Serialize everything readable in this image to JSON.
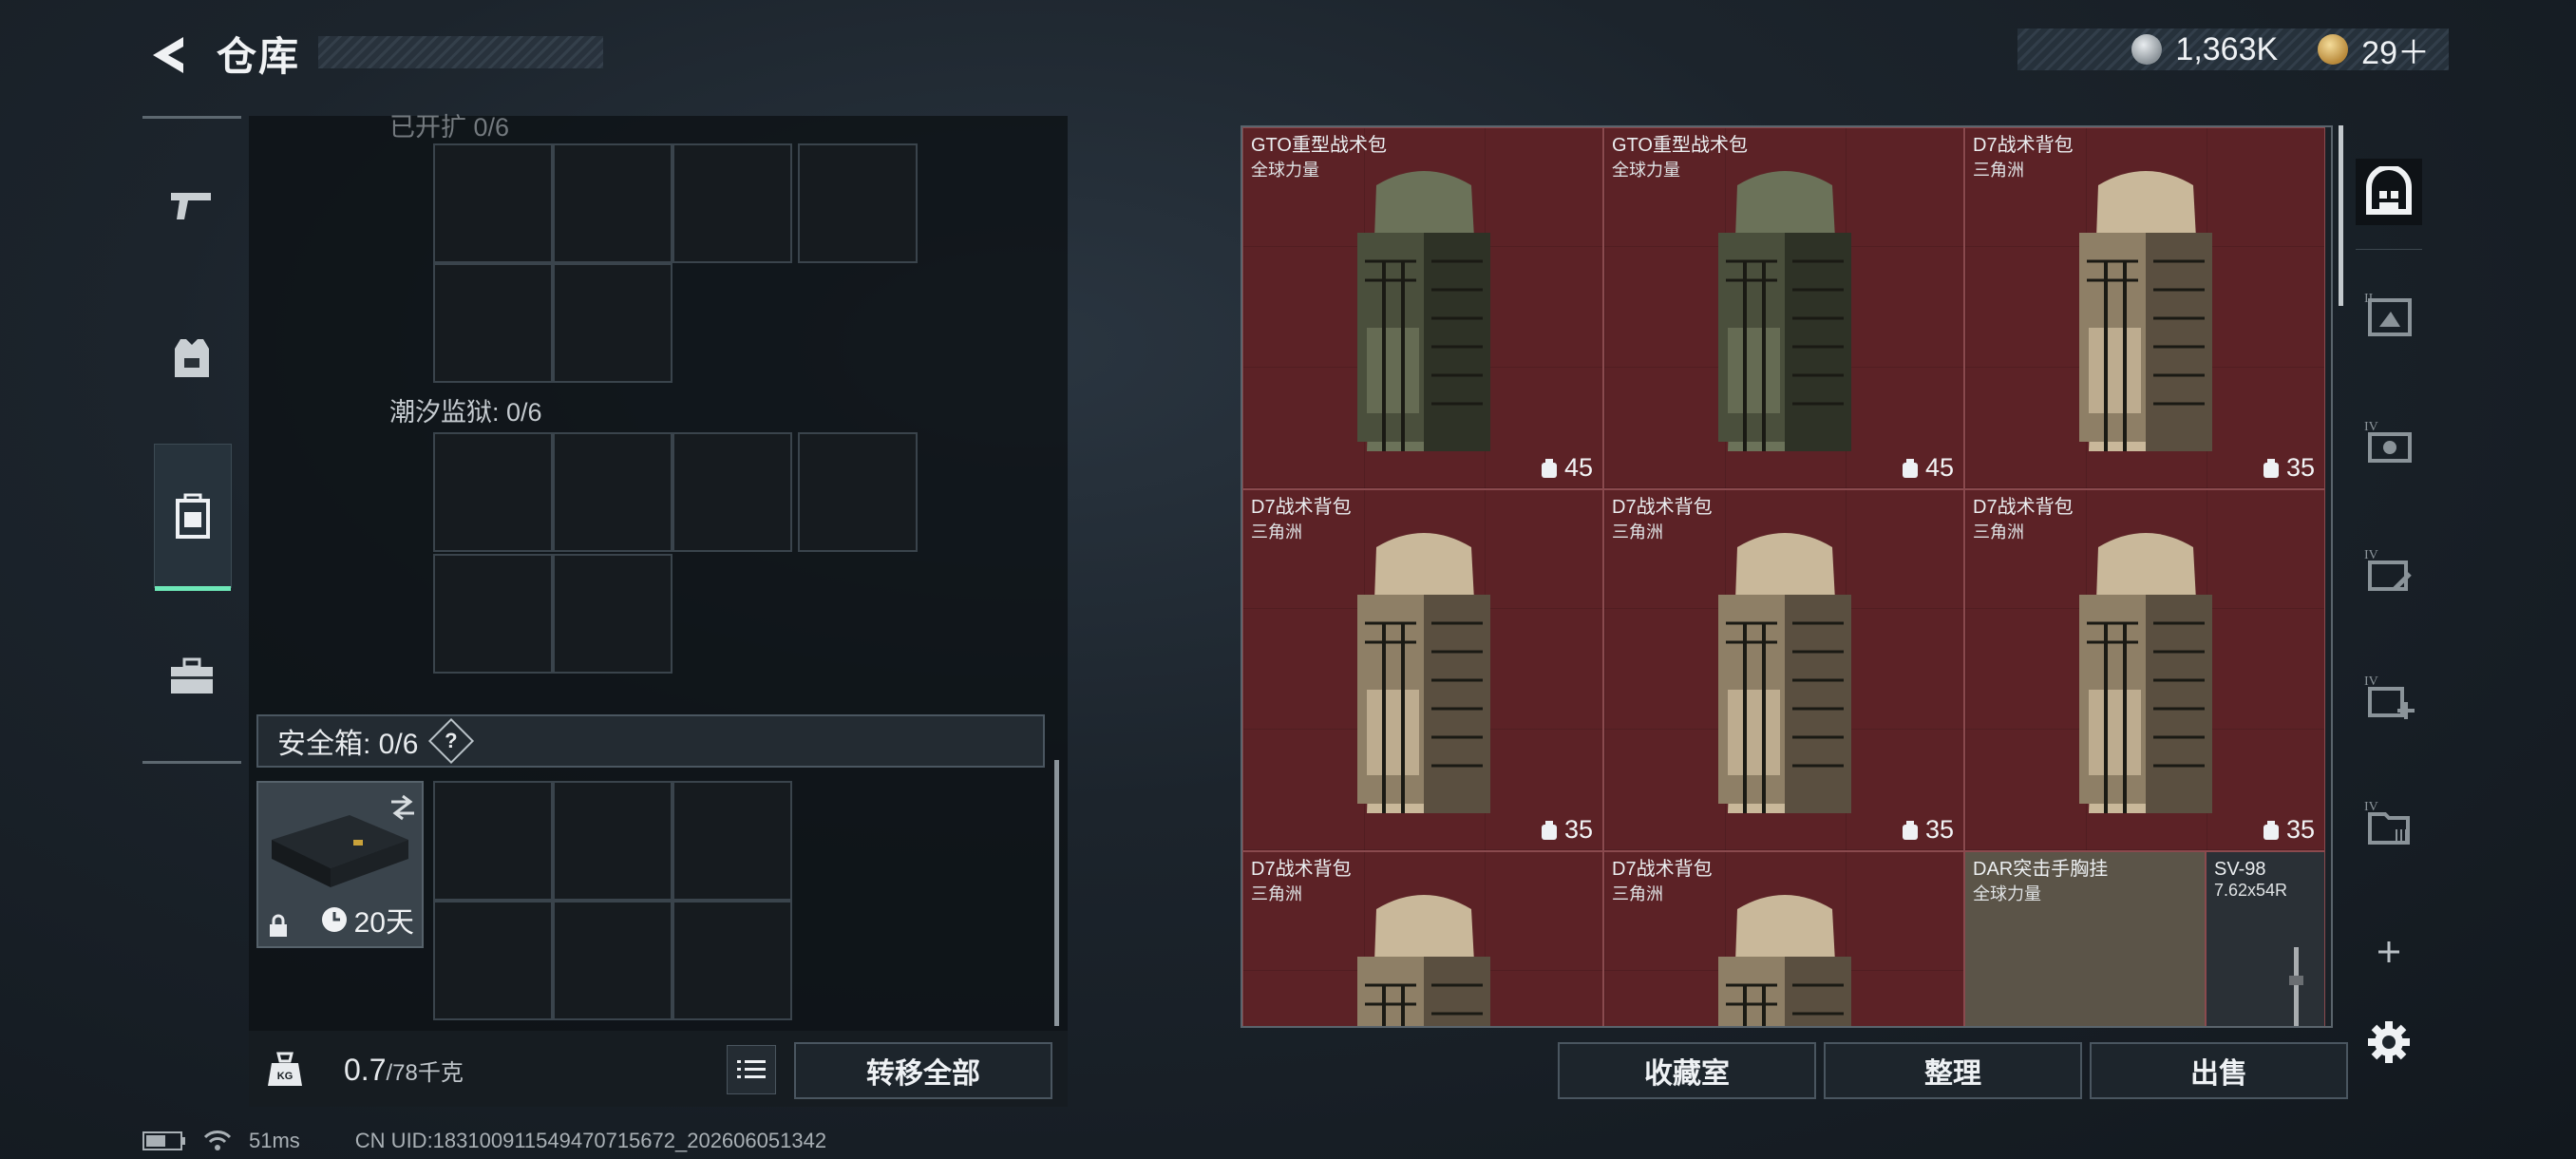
{
  "header": {
    "title": "仓库",
    "back_icon": "back-arrow-icon"
  },
  "currency": {
    "silver_value": "1,363K",
    "gold_value": "29＋",
    "silver_icon": "silver-coin-icon",
    "gold_icon": "gold-coin-icon"
  },
  "left_rail": [
    {
      "id": "weapons",
      "icon": "pistol-icon",
      "active": false
    },
    {
      "id": "armor",
      "icon": "vest-icon",
      "active": false
    },
    {
      "id": "backpack",
      "icon": "backpack-icon",
      "active": true
    },
    {
      "id": "toolbox",
      "icon": "briefcase-icon",
      "active": false
    }
  ],
  "containers": {
    "top_label_cut": "已开扩 0/6",
    "tide_prison_label": "潮汐监狱: 0/6",
    "safe_box_label": "安全箱: 0/6",
    "safe_box_help": "?",
    "safe_box_days": "20天"
  },
  "weight": {
    "current": "0.7",
    "max_unit": "/78千克"
  },
  "buttons": {
    "transfer_all": "转移全部",
    "collection": "收藏室",
    "organize": "整理",
    "sell": "出售"
  },
  "inventory": [
    {
      "name": "GTO重型战术包",
      "brand": "全球力量",
      "count": "45",
      "color": "green"
    },
    {
      "name": "GTO重型战术包",
      "brand": "全球力量",
      "count": "45",
      "color": "green"
    },
    {
      "name": "D7战术背包",
      "brand": "三角洲",
      "count": "35",
      "color": "tan"
    },
    {
      "name": "D7战术背包",
      "brand": "三角洲",
      "count": "35",
      "color": "tan"
    },
    {
      "name": "D7战术背包",
      "brand": "三角洲",
      "count": "35",
      "color": "tan"
    },
    {
      "name": "D7战术背包",
      "brand": "三角洲",
      "count": "35",
      "color": "tan"
    },
    {
      "name": "D7战术背包",
      "brand": "三角洲",
      "count": "",
      "color": "tan"
    },
    {
      "name": "D7战术背包",
      "brand": "三角洲",
      "count": "",
      "color": "tan"
    },
    {
      "name": "DAR突击手胸挂",
      "brand": "全球力量",
      "count": "",
      "color": "olive"
    },
    {
      "name": "SV-98",
      "brand": "7.62x54R",
      "count": "",
      "color": "rifle"
    }
  ],
  "right_sidebar": [
    {
      "label": "",
      "icon": "home-vault-icon",
      "active": true
    },
    {
      "label": "II",
      "icon": "loadout-II-icon"
    },
    {
      "label": "IV",
      "icon": "loadout-IV-icon"
    },
    {
      "label": "IV",
      "icon": "loadout-IV-edit-icon"
    },
    {
      "label": "IV",
      "icon": "loadout-IV-add-icon"
    },
    {
      "label": "IV",
      "icon": "loadout-IV-folder-icon"
    }
  ],
  "status_bar": {
    "ping": "51ms",
    "uid": "CN UID:18310091154947071567​2_202606051342"
  }
}
